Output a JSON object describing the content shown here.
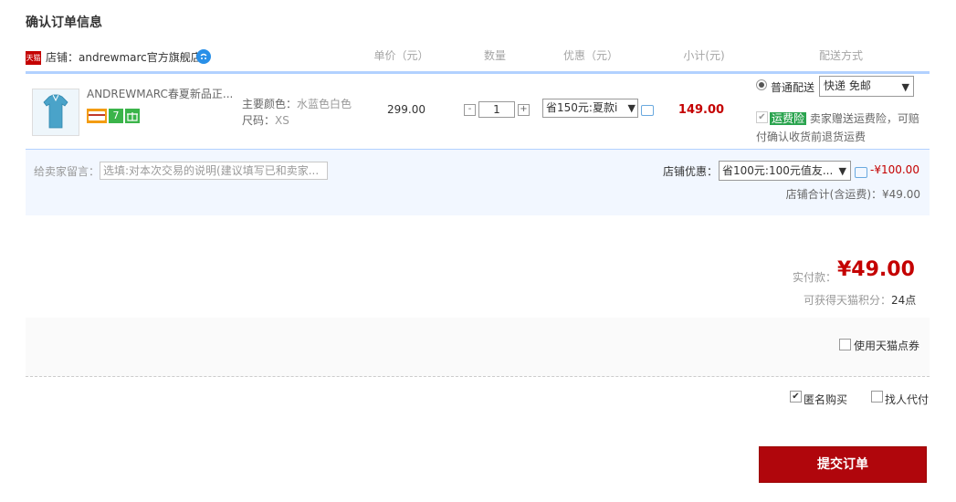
{
  "page": {
    "title": "确认订单信息"
  },
  "header": {
    "shop_prefix": "店铺：",
    "shop_name": "andrewmarc官方旗舰店",
    "shop_icon_text": "天猫",
    "columns": {
      "unit_price": "单价（元）",
      "quantity": "数量",
      "discount": "优惠（元）",
      "subtotal": "小计(元)",
      "shipping": "配送方式"
    }
  },
  "item": {
    "title": "ANDREWMARC春夏新品正...",
    "color_label": "主要颜色：",
    "color_value": "水蓝色白色",
    "size_label": "尺码：",
    "size_value": "XS",
    "unit_price": "299.00",
    "quantity": "1",
    "qty_minus": "-",
    "qty_plus": "+",
    "discount_option": "省150元:夏款i",
    "subtotal": "149.00",
    "badge_7": "7"
  },
  "shipping": {
    "method_label": "普通配送",
    "method_option": "快递 免邮",
    "insurance_tag": "运费险",
    "insurance_text_1": "卖家赠送运费险，可赔",
    "insurance_text_2": "付确认收货前退货运费"
  },
  "message": {
    "label": "给卖家留言：",
    "placeholder": "选填:对本次交易的说明(建议填写已和卖家..."
  },
  "shop_discount": {
    "label": "店铺优惠：",
    "option": "省100元:100元值友...",
    "value": "-¥100.00",
    "total": "店铺合计(含运费)：¥49.00"
  },
  "payment": {
    "label": "实付款：",
    "amount": "¥49.00",
    "points_label": "可获得天猫积分：",
    "points_value": "24点"
  },
  "options": {
    "use_coupon": "使用天猫点券",
    "anonymous": "匿名购买",
    "proxy_pay": "找人代付"
  },
  "submit": {
    "label": "提交订单"
  },
  "colors": {
    "accent_red": "#c40000",
    "submit_bg": "#b0060c",
    "header_border": "#b2d1ff"
  }
}
